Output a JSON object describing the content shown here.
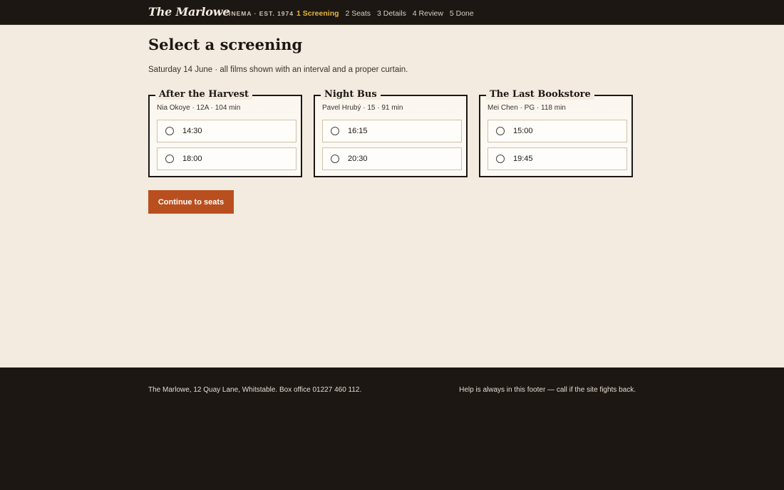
{
  "header": {
    "brand": "The Marlowe",
    "tagline": "CINEMA · EST. 1974",
    "steps": [
      {
        "label": "1 Screening",
        "active": true
      },
      {
        "label": "2 Seats",
        "active": false
      },
      {
        "label": "3 Details",
        "active": false
      },
      {
        "label": "4 Review",
        "active": false
      },
      {
        "label": "5 Done",
        "active": false
      }
    ]
  },
  "main": {
    "title": "Select a screening",
    "subtitle": "Saturday 14 June · all films shown with an interval and a proper curtain.",
    "films": [
      {
        "title": "After the Harvest",
        "meta": "Nia Okoye · 12A · 104 min",
        "times": [
          "14:30",
          "18:00"
        ]
      },
      {
        "title": "Night Bus",
        "meta": "Pavel Hrubý · 15 · 91 min",
        "times": [
          "16:15",
          "20:30"
        ]
      },
      {
        "title": "The Last Bookstore",
        "meta": "Mei Chen · PG · 118 min",
        "times": [
          "15:00",
          "19:45"
        ]
      }
    ],
    "continue_label": "Continue to seats"
  },
  "footer": {
    "address": "The Marlowe, 12 Quay Lane, Whitstable. Box office 01227 460 112.",
    "help": "Help is always in this footer — call if the site fights back."
  },
  "colors": {
    "accent": "#b94f1e",
    "active_step": "#e8b53c",
    "dark": "#1c1713",
    "background": "#f3ebdf"
  }
}
